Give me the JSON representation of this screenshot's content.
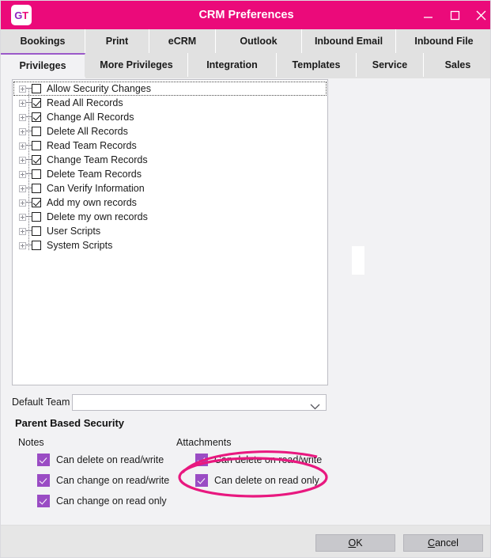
{
  "window": {
    "title": "CRM Preferences",
    "logo_left": "G",
    "logo_right": "T",
    "controls": {
      "minimize": "minimize-icon",
      "maximize": "maximize-icon",
      "close": "close-icon"
    }
  },
  "tabs": {
    "row1": [
      {
        "label": "Bookings",
        "active": false,
        "width": 107
      },
      {
        "label": "Print",
        "active": false,
        "width": 81
      },
      {
        "label": "eCRM",
        "active": false,
        "width": 84
      },
      {
        "label": "Outlook",
        "active": false,
        "width": 109
      },
      {
        "label": "Inbound Email",
        "active": false,
        "width": 119
      },
      {
        "label": "Inbound File",
        "active": false,
        "width": 121
      }
    ],
    "row2": [
      {
        "label": "Privileges",
        "active": true,
        "width": 107
      },
      {
        "label": "More Privileges",
        "active": false,
        "width": 130
      },
      {
        "label": "Integration",
        "active": false,
        "width": 112
      },
      {
        "label": "Templates",
        "active": false,
        "width": 101
      },
      {
        "label": "Service",
        "active": false,
        "width": 85
      },
      {
        "label": "Sales",
        "active": false,
        "width": 86
      }
    ]
  },
  "privileges_list": [
    {
      "label": "Allow Security Changes",
      "checked": false,
      "focused": true
    },
    {
      "label": "Read All Records",
      "checked": true,
      "focused": false
    },
    {
      "label": "Change All Records",
      "checked": true,
      "focused": false
    },
    {
      "label": "Delete All Records",
      "checked": false,
      "focused": false
    },
    {
      "label": "Read Team Records",
      "checked": false,
      "focused": false
    },
    {
      "label": "Change Team Records",
      "checked": true,
      "focused": false
    },
    {
      "label": "Delete Team Records",
      "checked": false,
      "focused": false
    },
    {
      "label": "Can Verify Information",
      "checked": false,
      "focused": false
    },
    {
      "label": "Add my own records",
      "checked": true,
      "focused": false
    },
    {
      "label": "Delete my own records",
      "checked": false,
      "focused": false
    },
    {
      "label": "User Scripts",
      "checked": false,
      "focused": false
    },
    {
      "label": "System Scripts",
      "checked": false,
      "focused": false
    }
  ],
  "default_team": {
    "label": "Default Team",
    "value": "",
    "placeholder": ""
  },
  "parent_based_security": {
    "title": "Parent Based Security",
    "notes": {
      "heading": "Notes",
      "items": [
        {
          "label": "Can delete on read/write",
          "checked": true
        },
        {
          "label": "Can change on read/write",
          "checked": true
        },
        {
          "label": "Can change on read only",
          "checked": true
        }
      ]
    },
    "attachments": {
      "heading": "Attachments",
      "items": [
        {
          "label": "Can delete on read/write",
          "checked": true
        },
        {
          "label": "Can delete on read only",
          "checked": true
        }
      ]
    }
  },
  "annotation": {
    "shape": "ellipse",
    "color": "#e8187f",
    "target": "Can delete on read only"
  },
  "footer": {
    "ok": {
      "accel": "O",
      "rest": "K"
    },
    "cancel": {
      "accel": "C",
      "rest": "ancel"
    }
  },
  "colors": {
    "titlebar": "#eb0a7a",
    "accent_tab": "#9b59c9",
    "checkbox_purple": "#9a4cc4",
    "annotation": "#e8187f"
  }
}
